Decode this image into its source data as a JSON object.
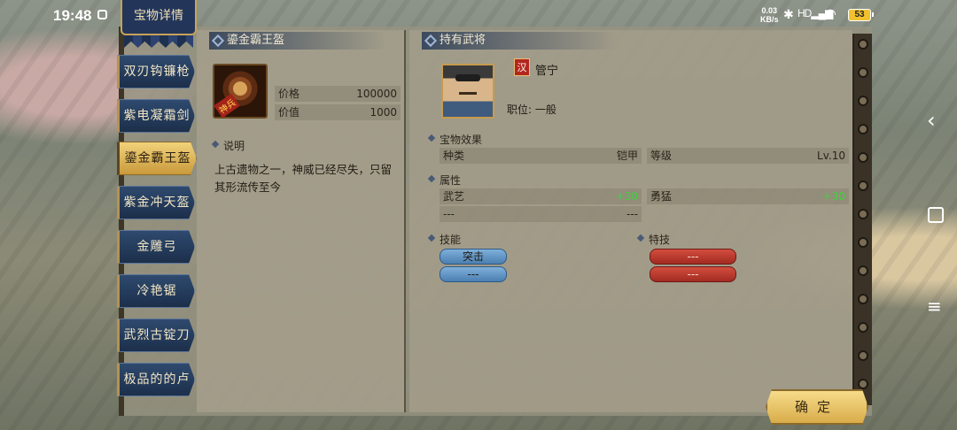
{
  "status": {
    "time": "19:48",
    "net_speed_value": "0.03",
    "net_speed_unit": "KB/s",
    "signal_label": "HD",
    "battery": "53"
  },
  "title": "宝物详情",
  "items": [
    {
      "label": "双刃钩镰枪"
    },
    {
      "label": "紫电凝霜剑"
    },
    {
      "label": "鎏金霸王盔"
    },
    {
      "label": "紫金冲天盔"
    },
    {
      "label": "金雕弓"
    },
    {
      "label": "冷艳锯"
    },
    {
      "label": "武烈古锭刀"
    },
    {
      "label": "极品的的卢"
    }
  ],
  "detail": {
    "name": "鎏金霸王盔",
    "icon_badge": "神兵",
    "price_label": "价格",
    "price_value": "100000",
    "worth_label": "价值",
    "worth_value": "1000",
    "desc_label": "说明",
    "description": "上古遗物之一，神威已经尽失，只留其形流传至今"
  },
  "holder": {
    "header": "持有武将",
    "faction": "汉",
    "name": "管宁",
    "position": "职位: 一般",
    "effects_label": "宝物效果",
    "type_label": "种类",
    "type_value": "铠甲",
    "level_label": "等级",
    "level_value": "Lv.10",
    "attr_label": "属性",
    "attr1_name": "武艺",
    "attr1_value": "+30",
    "attr2_name": "勇猛",
    "attr2_value": "+30",
    "attr3_name": "---",
    "attr3_value": "---",
    "skill_label": "技能",
    "skill1": "突击",
    "skill2": "---",
    "special_label": "特技",
    "special1": "---",
    "special2": "---"
  },
  "confirm": "确定",
  "colors": {
    "accent_gold": "#d9ac4a",
    "tab_blue": "#1c2f4b",
    "green_value": "#3bd43b",
    "skill_red": "#a22b22"
  }
}
